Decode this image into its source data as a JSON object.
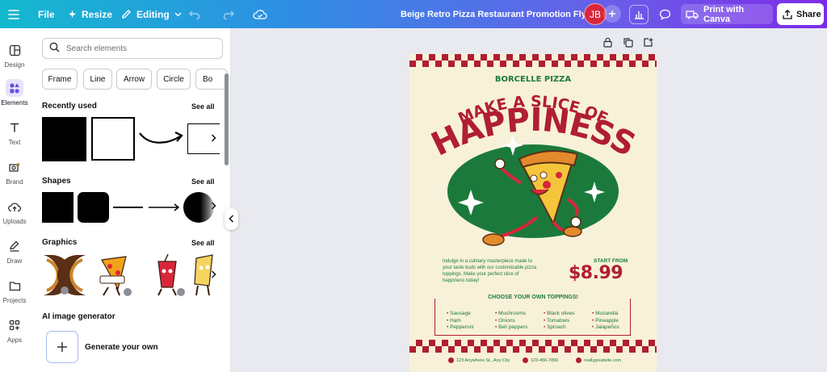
{
  "topbar": {
    "file_label": "File",
    "resize_label": "Resize",
    "editing_label": "Editing",
    "doc_title": "Beige Retro Pizza Restaurant Promotion Flyer",
    "avatar_initials": "JB",
    "print_label": "Print with Canva",
    "share_label": "Share"
  },
  "rail": {
    "items": [
      {
        "label": "Design"
      },
      {
        "label": "Elements"
      },
      {
        "label": "Text"
      },
      {
        "label": "Brand"
      },
      {
        "label": "Uploads"
      },
      {
        "label": "Draw"
      },
      {
        "label": "Projects"
      },
      {
        "label": "Apps"
      }
    ],
    "active": "Elements"
  },
  "panel": {
    "search_placeholder": "Search elements",
    "chips": [
      "Frame",
      "Line",
      "Arrow",
      "Circle",
      "Bo"
    ],
    "sections": {
      "recently_used": "Recently used",
      "shapes": "Shapes",
      "graphics": "Graphics",
      "ai_generator": "AI image generator"
    },
    "see_all": "See all",
    "generate_label": "Generate your own"
  },
  "flyer": {
    "brand": "BORCELLE PIZZA",
    "headline_1": "MAKE A SLICE OF",
    "headline_2": "HAPPINESS",
    "description": "Indulge in a culinary masterpiece made to your taste buds with our customizable pizza toppings. Make your perfect slice of happiness today!",
    "start_from": "START FROM",
    "price": "$8.99",
    "toppings_title": "CHOOSE YOUR OWN TOPPINGS!",
    "toppings": [
      [
        "Sausage",
        "Ham",
        "Pepperoni"
      ],
      [
        "Mushrooms",
        "Onions",
        "Bell peppers"
      ],
      [
        "Black olives",
        "Tomatoes",
        "Spinach"
      ],
      [
        "Mozarella",
        "Pineapple",
        "Jalapeños"
      ]
    ],
    "footer": {
      "address": "123 Anywhere St., Any City",
      "phone": "123-456-7890",
      "site": "reallygreatsite.com"
    }
  },
  "colors": {
    "accent_red": "#b01e31",
    "flyer_green": "#1b7a3b",
    "flyer_bg": "#f8f1d9"
  }
}
